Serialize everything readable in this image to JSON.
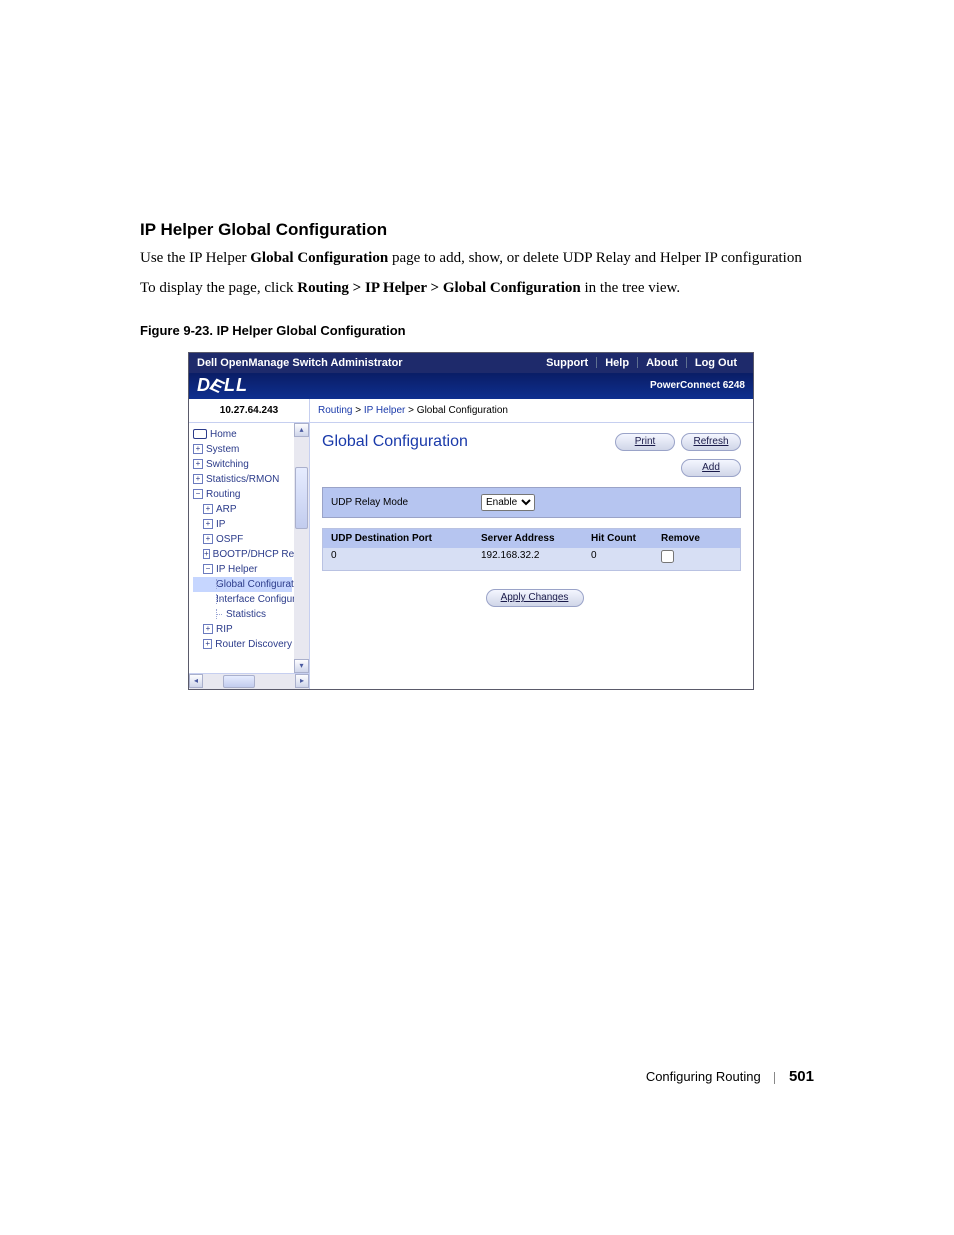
{
  "section_heading": "IP Helper Global Configuration",
  "para1_pre": "Use the IP Helper ",
  "para1_bold": "Global Configuration",
  "para1_post": " page to add, show, or delete UDP Relay and Helper IP configuration",
  "para2_pre": "To display the page, click ",
  "para2_bold": "Routing > IP Helper > Global Configuration",
  "para2_post": " in the tree view.",
  "figure_caption": "Figure 9-23.    IP Helper Global Configuration",
  "titlebar": {
    "title": "Dell OpenManage Switch Administrator",
    "support": "Support",
    "help": "Help",
    "about": "About",
    "logout": "Log Out"
  },
  "brand": {
    "logo_text": "DELL",
    "product": "PowerConnect 6248"
  },
  "sidebar": {
    "ip": "10.27.64.243",
    "nodes": [
      {
        "indent": 0,
        "icon": "home",
        "label": "Home"
      },
      {
        "indent": 0,
        "icon": "plus",
        "label": "System"
      },
      {
        "indent": 0,
        "icon": "plus",
        "label": "Switching"
      },
      {
        "indent": 0,
        "icon": "plus",
        "label": "Statistics/RMON"
      },
      {
        "indent": 0,
        "icon": "minus",
        "label": "Routing"
      },
      {
        "indent": 1,
        "icon": "plus",
        "label": "ARP"
      },
      {
        "indent": 1,
        "icon": "plus",
        "label": "IP"
      },
      {
        "indent": 1,
        "icon": "plus",
        "label": "OSPF"
      },
      {
        "indent": 1,
        "icon": "plus",
        "label": "BOOTP/DHCP Relay Agent"
      },
      {
        "indent": 1,
        "icon": "minus",
        "label": "IP Helper"
      },
      {
        "indent": 2,
        "icon": "conn",
        "label": "Global Configuration",
        "highlight": true
      },
      {
        "indent": 2,
        "icon": "conn",
        "label": "Interface Configuration"
      },
      {
        "indent": 2,
        "icon": "conn",
        "label": "Statistics"
      },
      {
        "indent": 1,
        "icon": "plus",
        "label": "RIP"
      },
      {
        "indent": 1,
        "icon": "plus",
        "label": "Router Discovery"
      }
    ]
  },
  "breadcrumb": {
    "a": "Routing",
    "b": "IP Helper",
    "c": "Global Configuration",
    "sep": ">"
  },
  "content": {
    "title": "Global Configuration",
    "print": "Print",
    "refresh": "Refresh",
    "add": "Add",
    "relay_label": "UDP Relay Mode",
    "relay_value": "Enable",
    "table": {
      "h1": "UDP Destination Port",
      "h2": "Server Address",
      "h3": "Hit Count",
      "h4": "Remove",
      "row": {
        "c1": "0",
        "c2": "192.168.32.2",
        "c3": "0"
      }
    },
    "apply": "Apply Changes"
  },
  "footer": {
    "section": "Configuring Routing",
    "page": "501"
  }
}
